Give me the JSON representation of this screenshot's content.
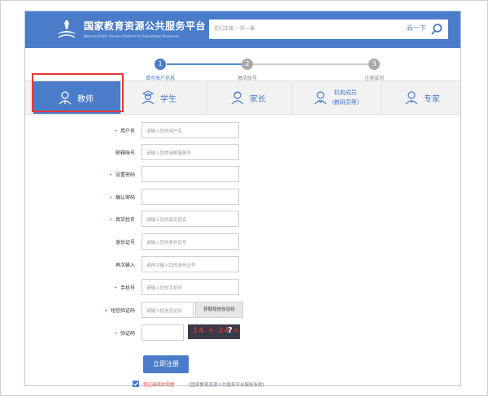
{
  "header": {
    "title": "国家教育资源公共服务平台",
    "subtitle": "National Public Service Platform for Educational Resources",
    "search_placeholder": "您们正搜:一样一课",
    "search_button": "云一下"
  },
  "steps": [
    {
      "num": "1",
      "label": "填写账户信息",
      "active": true
    },
    {
      "num": "2",
      "label": "激活账号",
      "active": false
    },
    {
      "num": "3",
      "label": "注册成功",
      "active": false
    }
  ],
  "roles": [
    {
      "label": "教师",
      "active": true
    },
    {
      "label": "学生",
      "active": false
    },
    {
      "label": "家长",
      "active": false
    },
    {
      "label": "机构成员",
      "label2": "(教研员等)",
      "active": false
    },
    {
      "label": "专家",
      "active": false
    }
  ],
  "form": {
    "username": {
      "label": "用户名",
      "required": true,
      "placeholder": "请输入您的用户名"
    },
    "email": {
      "label": "邮箱账号",
      "required": false,
      "placeholder": "请输入您常用邮箱账号"
    },
    "password": {
      "label": "设置密码",
      "required": true,
      "placeholder": ""
    },
    "confirm_password": {
      "label": "确认密码",
      "required": true,
      "placeholder": ""
    },
    "real_name": {
      "label": "真实姓名",
      "required": true,
      "placeholder": "请输入您的真实姓名"
    },
    "id_number": {
      "label": "身份证号",
      "required": false,
      "placeholder": "请输入您的身份证号"
    },
    "id_confirm": {
      "label": "再次输入",
      "required": false,
      "placeholder": "请再次输入您的身份证号"
    },
    "phone": {
      "label": "手机号",
      "required": true,
      "placeholder": "请输入您的手机号"
    },
    "sms_code": {
      "label": "短信验证码",
      "required": true,
      "placeholder": "请输入短信验证码",
      "button": "获取短信验证码"
    },
    "captcha": {
      "label": "验证码",
      "required": true,
      "placeholder": "",
      "image_text": "14 + 24 =",
      "image_mark": "?"
    },
    "submit": "立即注册",
    "agree_text": "您已阅读并同意",
    "agree_link": "《国家教育资源公共服务平台服务条款》"
  },
  "colors": {
    "brand": "#4a7cc9",
    "required": "#e53935",
    "highlight": "#e53935"
  }
}
